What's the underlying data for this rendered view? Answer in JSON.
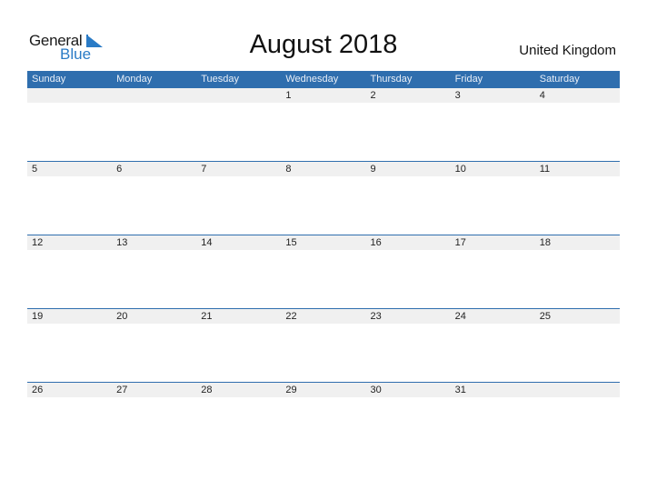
{
  "logo": {
    "word1": "General",
    "word2": "Blue",
    "icon": "triangle-flag-icon",
    "brand_color": "#2a7bc6"
  },
  "title": "August 2018",
  "country": "United Kingdom",
  "colors": {
    "header_bg": "#2f6eae",
    "date_strip_bg": "#f0f0f0"
  },
  "weekdays": [
    "Sunday",
    "Monday",
    "Tuesday",
    "Wednesday",
    "Thursday",
    "Friday",
    "Saturday"
  ],
  "weeks": [
    [
      "",
      "",
      "",
      "1",
      "2",
      "3",
      "4"
    ],
    [
      "5",
      "6",
      "7",
      "8",
      "9",
      "10",
      "11"
    ],
    [
      "12",
      "13",
      "14",
      "15",
      "16",
      "17",
      "18"
    ],
    [
      "19",
      "20",
      "21",
      "22",
      "23",
      "24",
      "25"
    ],
    [
      "26",
      "27",
      "28",
      "29",
      "30",
      "31",
      ""
    ]
  ]
}
